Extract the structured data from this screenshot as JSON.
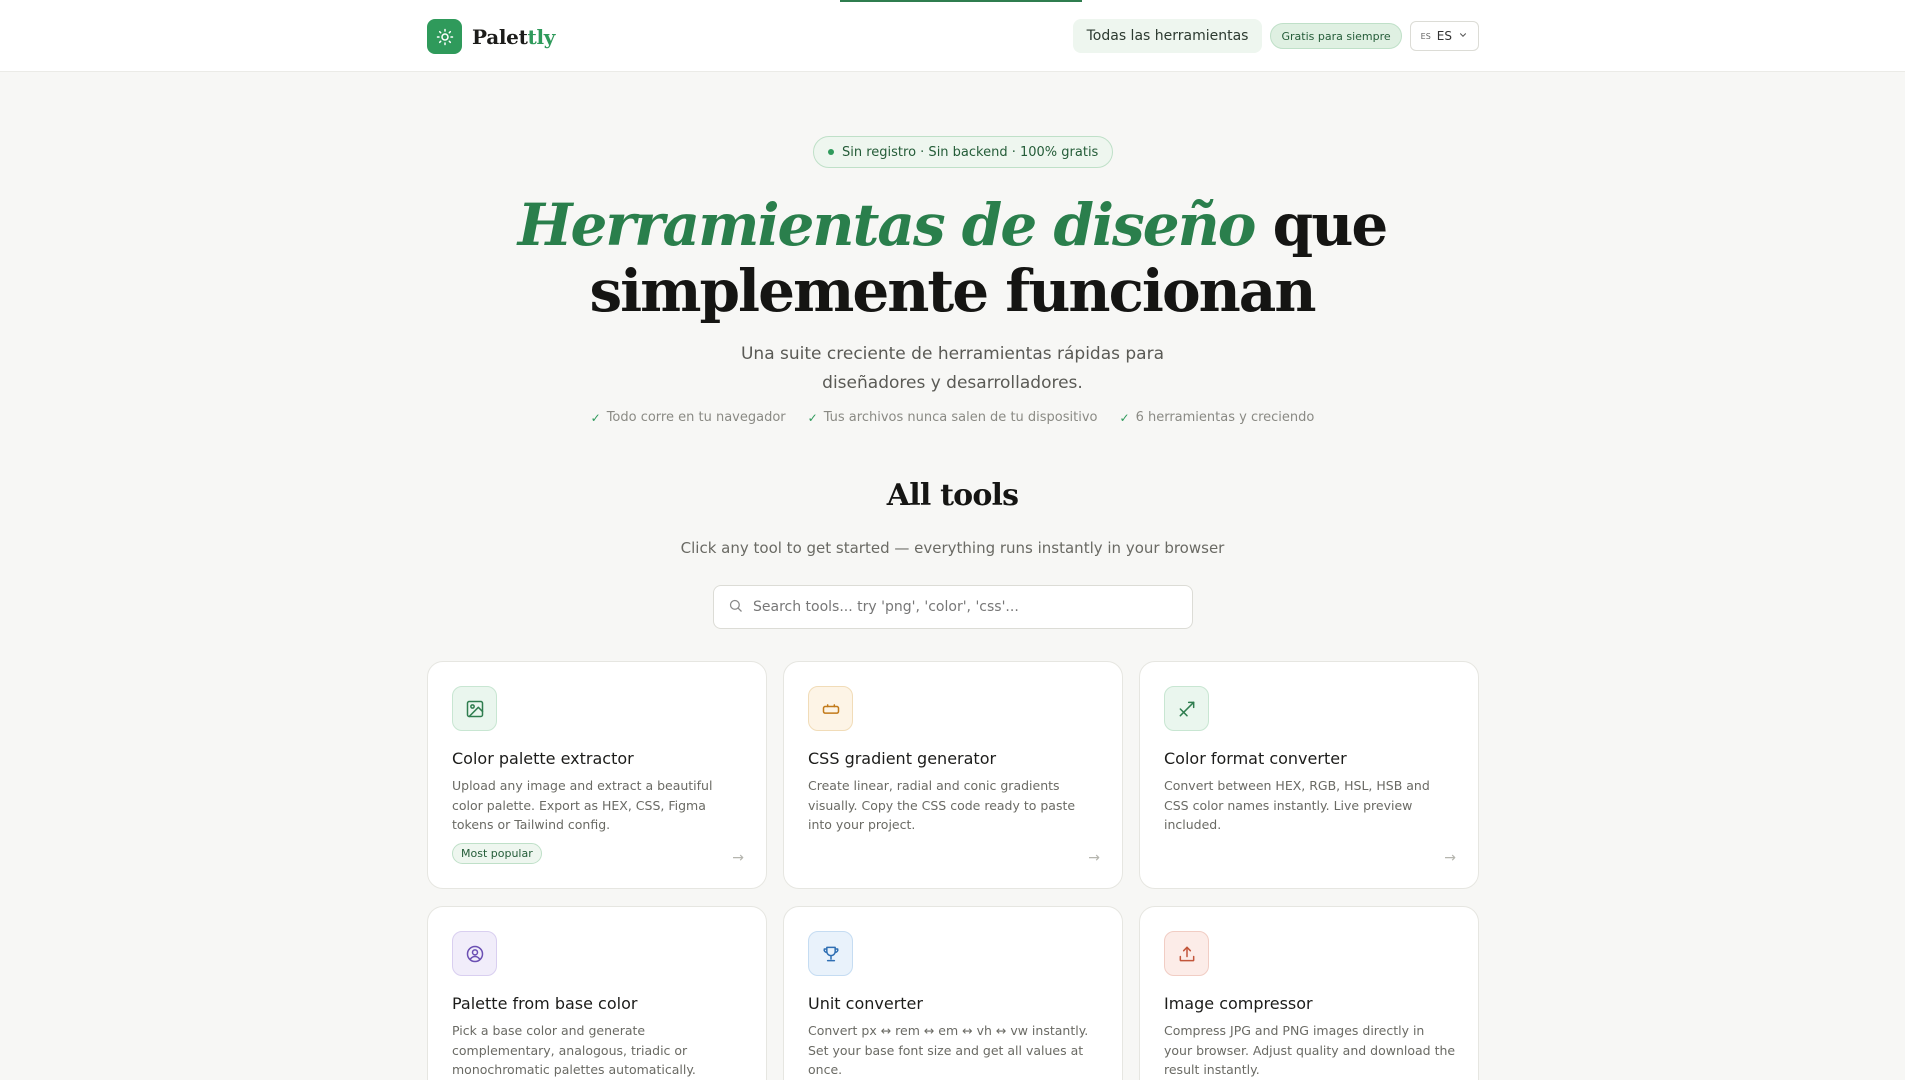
{
  "header": {
    "brand_prefix": "Palet",
    "brand_accent": "tly",
    "nav_link": "Todas las herramientas",
    "nav_pill": "Gratis para siempre",
    "lang_flag": "ES",
    "lang_label": "ES"
  },
  "hero": {
    "badge": "Sin registro · Sin backend · 100% gratis",
    "headline_accent": "Herramientas de diseño",
    "headline_rest": " que simplemente funcionan",
    "subtitle": "Una suite creciente de herramientas rápidas para diseñadores y desarrolladores.",
    "checks": [
      "Todo corre en tu navegador",
      "Tus archivos nunca salen de tu dispositivo",
      "6 herramientas y creciendo"
    ]
  },
  "section": {
    "title": "All tools",
    "subtitle": "Click any tool to get started — everything runs instantly in your browser",
    "search_placeholder": "Search tools... try 'png', 'color', 'css'..."
  },
  "tools": [
    {
      "title": "Color palette extractor",
      "desc": "Upload any image and extract a beautiful color palette. Export as HEX, CSS, Figma tokens or Tailwind config.",
      "tag": "Most popular",
      "icon": "image-icon",
      "bg": "#eaf6ee",
      "border": "#c8e6d2",
      "color": "#2f7d4f"
    },
    {
      "title": "CSS gradient generator",
      "desc": "Create linear, radial and conic gradients visually. Copy the CSS code ready to paste into your project.",
      "icon": "gradient-icon",
      "bg": "#fdf4e6",
      "border": "#f1dcb8",
      "color": "#c27a1a"
    },
    {
      "title": "Color format converter",
      "desc": "Convert between HEX, RGB, HSL, HSB and CSS color names instantly. Live preview included.",
      "icon": "convert-arrow-icon",
      "bg": "#eaf6ee",
      "border": "#c8e6d2",
      "color": "#2f7d4f"
    },
    {
      "title": "Palette from base color",
      "desc": "Pick a base color and generate complementary, analogous, triadic or monochromatic palettes automatically.",
      "icon": "user-circle-icon",
      "bg": "#f1edfa",
      "border": "#d9cff0",
      "color": "#6b4fb3"
    },
    {
      "title": "Unit converter",
      "desc": "Convert px ↔ rem ↔ em ↔ vh ↔ vw instantly. Set your base font size and get all values at once.",
      "icon": "trophy-icon",
      "bg": "#e9f2fb",
      "border": "#c5dcf2",
      "color": "#2f6fb3"
    },
    {
      "title": "Image compressor",
      "desc": "Compress JPG and PNG images directly in your browser. Adjust quality and download the result instantly.",
      "icon": "upload-icon",
      "bg": "#fcece8",
      "border": "#f1cdc4",
      "color": "#c2553a"
    }
  ]
}
